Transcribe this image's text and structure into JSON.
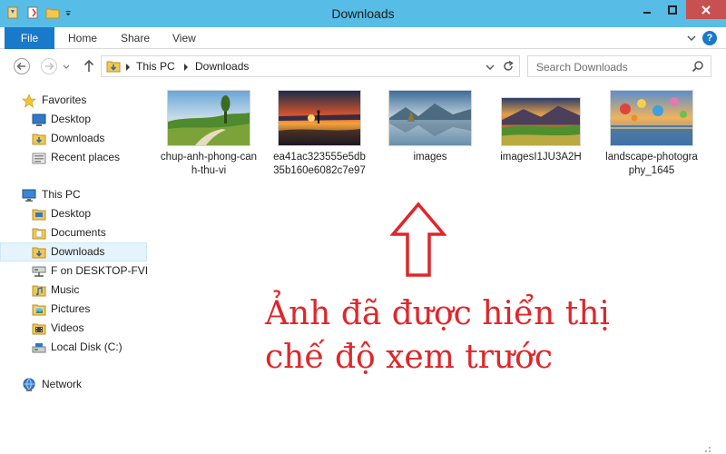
{
  "window": {
    "title": "Downloads"
  },
  "ribbon": {
    "tabs": [
      "File",
      "Home",
      "Share",
      "View"
    ],
    "help": "?"
  },
  "address": {
    "crumbs": [
      "This PC",
      "Downloads"
    ],
    "search_placeholder": "Search Downloads"
  },
  "sidebar": {
    "items": [
      {
        "label": "Favorites",
        "icon": "star-icon"
      },
      {
        "label": "Desktop",
        "icon": "desktop-icon"
      },
      {
        "label": "Downloads",
        "icon": "downloads-folder-icon"
      },
      {
        "label": "Recent places",
        "icon": "recent-places-icon"
      },
      {
        "label": "This PC",
        "icon": "computer-icon"
      },
      {
        "label": "Desktop",
        "icon": "folder-icon"
      },
      {
        "label": "Documents",
        "icon": "folder-icon"
      },
      {
        "label": "Downloads",
        "icon": "downloads-folder-icon",
        "selected": true
      },
      {
        "label": "F on DESKTOP-FVIC",
        "icon": "network-drive-icon"
      },
      {
        "label": "Music",
        "icon": "music-folder-icon"
      },
      {
        "label": "Pictures",
        "icon": "pictures-folder-icon"
      },
      {
        "label": "Videos",
        "icon": "videos-folder-icon"
      },
      {
        "label": "Local Disk (C:)",
        "icon": "local-disk-icon"
      },
      {
        "label": "Network",
        "icon": "network-icon"
      }
    ]
  },
  "files": [
    {
      "name": "chup-anh-phong-canh-thu-vi",
      "thumb": "autumn-road-landscape"
    },
    {
      "name": "ea41ac323555e5db35b160e6082c7e97",
      "thumb": "sunset-lake-figure"
    },
    {
      "name": "images",
      "thumb": "lake-mountain-reflection"
    },
    {
      "name": "imagesI1JU3A2H",
      "thumb": "mountain-sunrise-field"
    },
    {
      "name": "landscape-photography_1645",
      "thumb": "balloons-over-water"
    }
  ],
  "annotation": {
    "line1": "Ảnh đã được hiển thị",
    "line2": "chế độ xem trước"
  },
  "colors": {
    "titlebar": "#57bde6",
    "file_tab": "#1979ca",
    "close_button": "#c75050",
    "annotation": "#e0262a",
    "selection": "#e5f3fb"
  }
}
